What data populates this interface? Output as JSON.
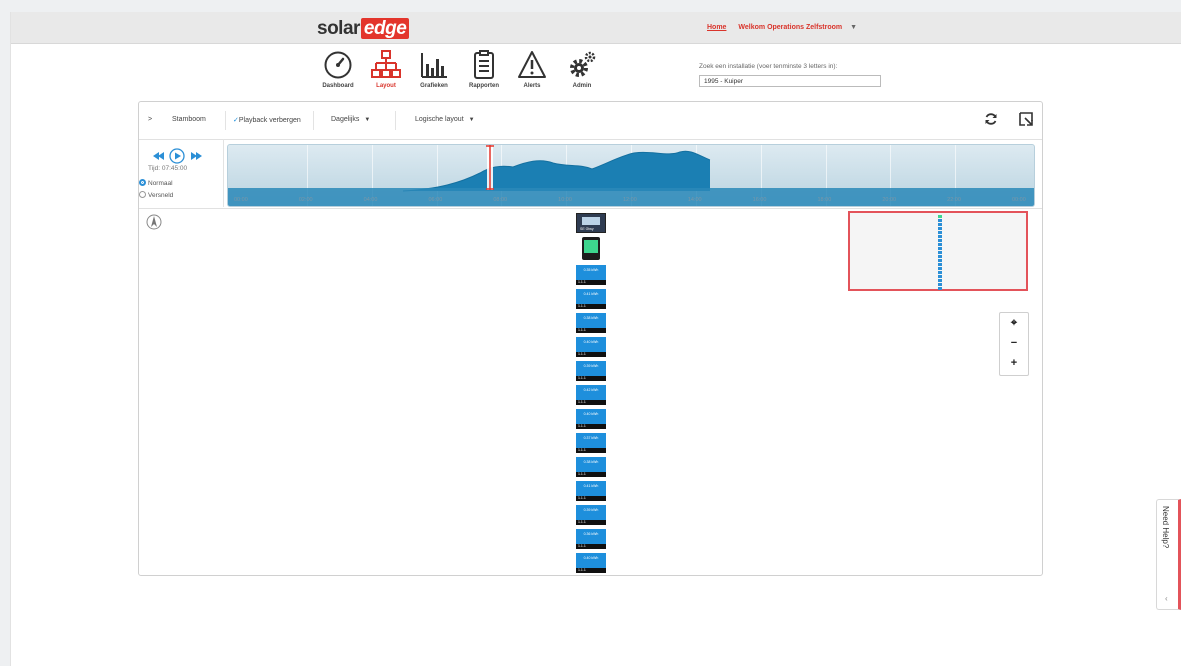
{
  "brand": {
    "solar": "solar",
    "edge": "edge"
  },
  "top_links": {
    "home": "Home",
    "user": "Welkom Operations Zelfstroom",
    "caret": "▼"
  },
  "nav": [
    {
      "label": "Dashboard",
      "icon": "gauge-icon"
    },
    {
      "label": "Layout",
      "icon": "layout-tree-icon",
      "active": true
    },
    {
      "label": "Grafieken",
      "icon": "bar-chart-icon"
    },
    {
      "label": "Rapporten",
      "icon": "clipboard-icon"
    },
    {
      "label": "Alerts",
      "icon": "warning-icon"
    },
    {
      "label": "Admin",
      "icon": "gears-icon"
    }
  ],
  "search": {
    "label": "Zoek een installatie (voer tenminste 3 letters in):",
    "value": "1995 - Kuiper"
  },
  "toolbar": {
    "stamboom_chevron": ">",
    "stamboom": "Stamboom",
    "playback_check": "✓",
    "playback": "Playback verbergen",
    "period": "Dagelijks",
    "layout": "Logische layout",
    "caret": "▼"
  },
  "playback": {
    "time": "Tijd: 07:45:00",
    "normal": "Normaal",
    "accelerated": "Versneld",
    "selected": "normal"
  },
  "timeline": {
    "ticks": [
      "00:00",
      "02:00",
      "04:00",
      "06:00",
      "08:00",
      "10:00",
      "12:00",
      "14:00",
      "16:00",
      "18:00",
      "20:00",
      "22:00",
      "00:00"
    ],
    "cursor_time": "07:45"
  },
  "layout_canvas": {
    "gateway_label": "SE Gtwy",
    "optimizers": [
      {
        "value": "0.35\nkWh"
      },
      {
        "value": "0.41\nkWh"
      },
      {
        "value": "0.38\nkWh"
      },
      {
        "value": "0.40\nkWh"
      },
      {
        "value": "0.39\nkWh"
      },
      {
        "value": "0.42\nkWh"
      },
      {
        "value": "0.40\nkWh"
      },
      {
        "value": "0.37\nkWh"
      },
      {
        "value": "0.38\nkWh"
      },
      {
        "value": "0.41\nkWh"
      },
      {
        "value": "0.39\nkWh"
      },
      {
        "value": "0.36\nkWh"
      },
      {
        "value": "0.40\nkWh"
      }
    ],
    "optimizer_foot": "1.1.1"
  },
  "zoom": {
    "fit": "⌖",
    "out": "−",
    "in": "+"
  },
  "help": {
    "label": "Need Help?",
    "arrow": "‹"
  },
  "colors": {
    "accent": "#d9342b",
    "optimizer": "#1e8fdc",
    "timeline_fill": "#1b7fb3"
  }
}
